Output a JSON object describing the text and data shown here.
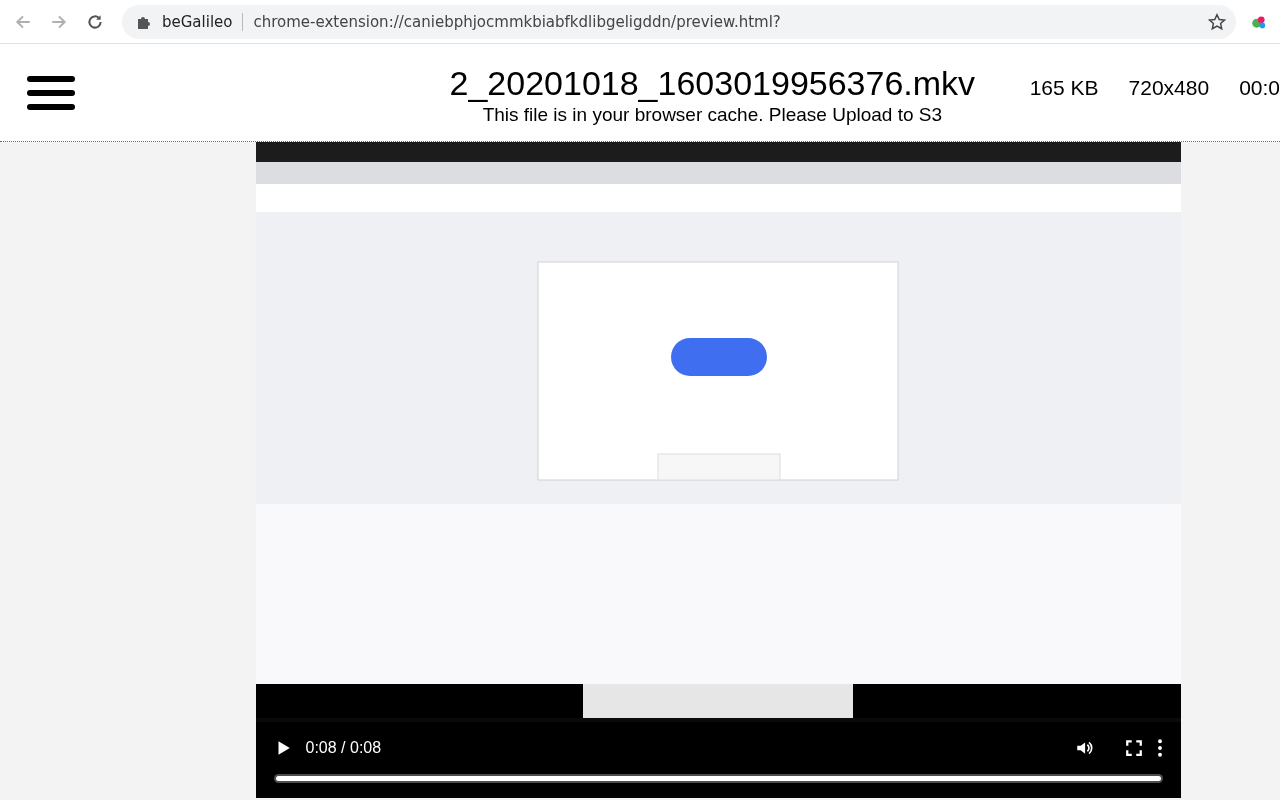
{
  "browser": {
    "site_name": "beGalileo",
    "url": "chrome-extension://caniebphjocmmkbiabfkdlibgeligddn/preview.html?"
  },
  "header": {
    "title": "2_20201018_1603019956376.mkv",
    "subtitle": "This file is in your browser cache. Please Upload to S3",
    "meta": [
      "165 KB",
      "720x480",
      "00:0"
    ]
  },
  "video": {
    "time": "0:08 / 0:08",
    "progress": {
      "level": 1.0
    }
  }
}
